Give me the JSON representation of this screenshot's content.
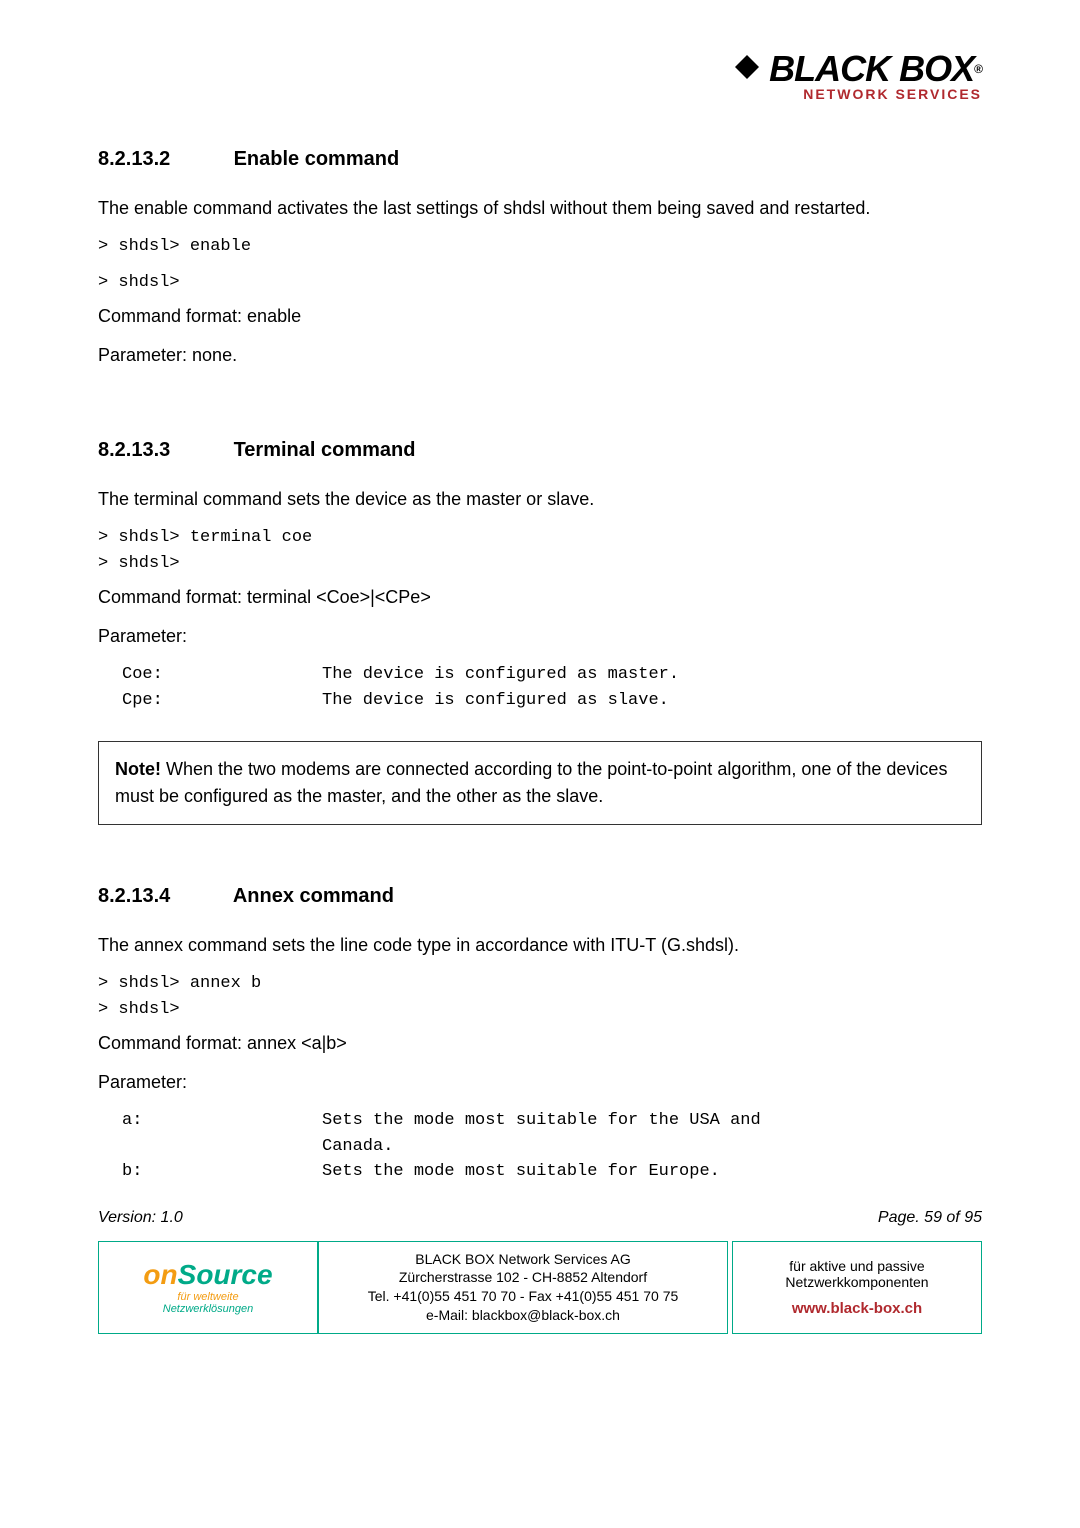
{
  "logo": {
    "brand": "BLACK BOX",
    "tagline": "NETWORK SERVICES"
  },
  "sec1": {
    "num": "8.2.13.2",
    "title": "Enable command",
    "desc": "The enable command activates the last settings of shdsl without them being saved and restarted.",
    "cmd1": "> shdsl> enable",
    "cmd2": "> shdsl>",
    "format": "Command format: enable",
    "param": "Parameter: none."
  },
  "sec2": {
    "num": "8.2.13.3",
    "title": "Terminal command",
    "desc": "The terminal command sets the device as the master or slave.",
    "cmd1": "> shdsl> terminal coe",
    "cmd2": "> shdsl>",
    "format": "Command format: terminal <Coe>|<CPe>",
    "param_label": "Parameter:",
    "p1_k": "Coe:",
    "p1_v": "The device is configured as master.",
    "p2_k": "Cpe:",
    "p2_v": "The device is configured as slave.",
    "note_bold": "Note!",
    "note_text": " When the two modems are connected according to the point-to-point algorithm, one of the devices must be configured as the master, and the other as the slave."
  },
  "sec3": {
    "num": "8.2.13.4",
    "title": "Annex command",
    "desc": "The annex command sets the line code type in accordance with ITU-T (G.shdsl).",
    "cmd1": "> shdsl> annex b",
    "cmd2": "> shdsl>",
    "format": "Command format: annex <a|b>",
    "param_label": "Parameter:",
    "p1_k": "a:",
    "p1_v": "Sets the mode most suitable for the USA and Canada.",
    "p2_k": "b:",
    "p2_v": "Sets the mode most suitable for Europe."
  },
  "footer": {
    "version": "Version: 1.0",
    "page": "Page. 59 of 95",
    "onsource_on": "on",
    "onsource_source": "Source",
    "onsource_sub1": "für weltweite",
    "onsource_sub2": "Netzwerklösungen",
    "company": "BLACK BOX Network Services AG",
    "address": "Zürcherstrasse 102 - CH-8852 Altendorf",
    "phone": "Tel. +41(0)55 451 70 70 - Fax +41(0)55 451 70 75",
    "email": "e-Mail: blackbox@black-box.ch",
    "right1": "für aktive und passive",
    "right2": "Netzwerkkomponenten",
    "url": "www.black-box.ch"
  }
}
